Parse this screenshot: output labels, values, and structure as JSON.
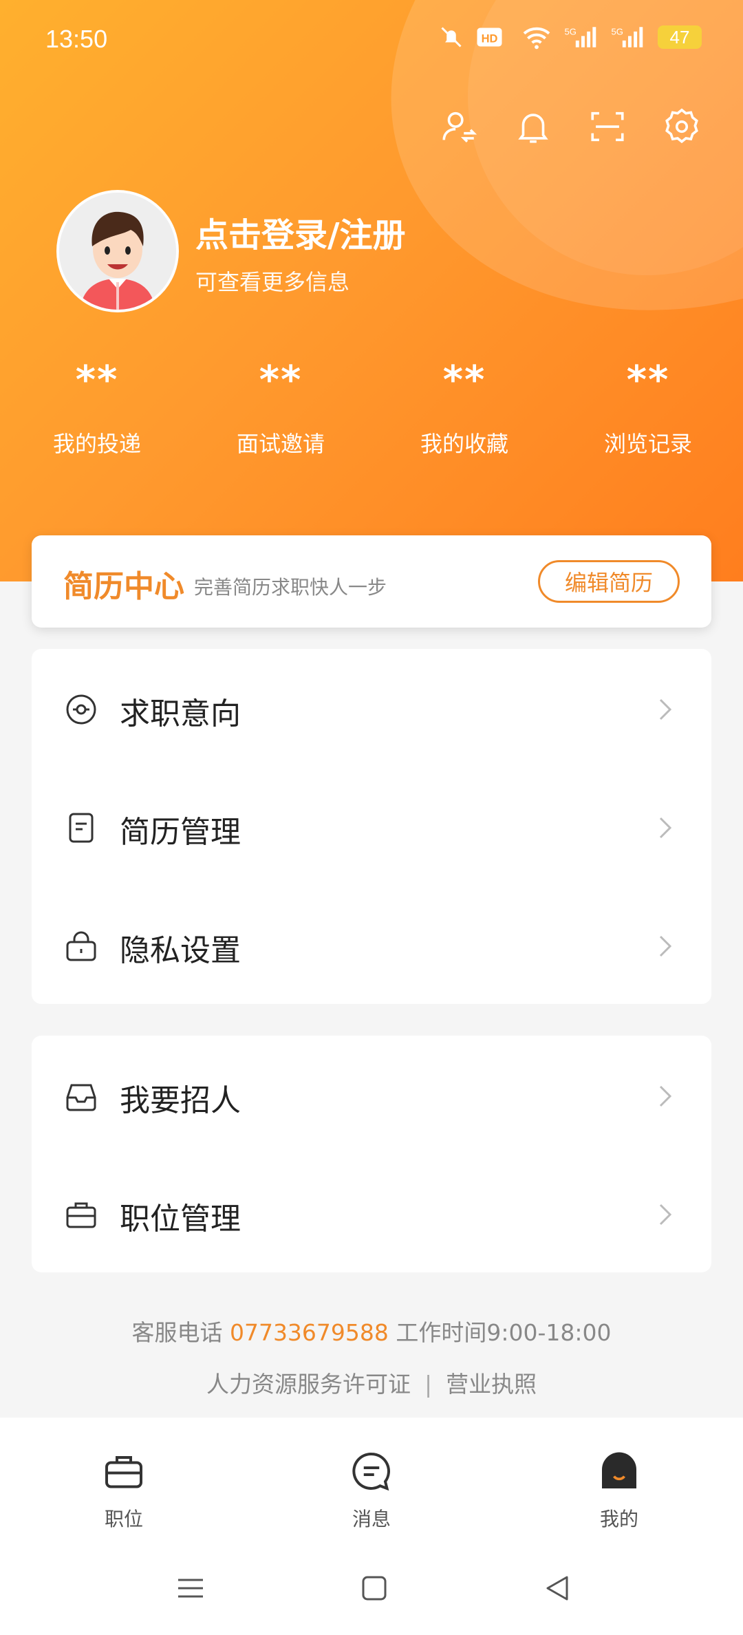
{
  "status_bar": {
    "time": "13:50",
    "battery": "47"
  },
  "header": {
    "login_title": "点击登录/注册",
    "login_subtitle": "可查看更多信息"
  },
  "stats": [
    {
      "value": "**",
      "label": "我的投递"
    },
    {
      "value": "**",
      "label": "面试邀请"
    },
    {
      "value": "**",
      "label": "我的收藏"
    },
    {
      "value": "**",
      "label": "浏览记录"
    }
  ],
  "resume_center": {
    "title": "简历中心",
    "subtitle": "完善简历求职快人一步",
    "button": "编辑简历"
  },
  "menu_group1": [
    {
      "label": "求职意向",
      "icon": "target-icon"
    },
    {
      "label": "简历管理",
      "icon": "document-icon"
    },
    {
      "label": "隐私设置",
      "icon": "lock-icon"
    }
  ],
  "menu_group2": [
    {
      "label": "我要招人",
      "icon": "inbox-icon"
    },
    {
      "label": "职位管理",
      "icon": "briefcase-icon"
    }
  ],
  "footer": {
    "service_label": "客服电话",
    "phone": "07733679588",
    "hours": "工作时间9:00-18:00",
    "license": "人力资源服务许可证",
    "separator": "|",
    "business": "营业执照"
  },
  "tabbar": [
    {
      "label": "职位",
      "icon": "briefcase-icon"
    },
    {
      "label": "消息",
      "icon": "chat-icon"
    },
    {
      "label": "我的",
      "icon": "profile-icon"
    }
  ],
  "colors": {
    "accent": "#f08a2a",
    "hero_start": "#ffb02e",
    "hero_end": "#ff7e1e"
  }
}
